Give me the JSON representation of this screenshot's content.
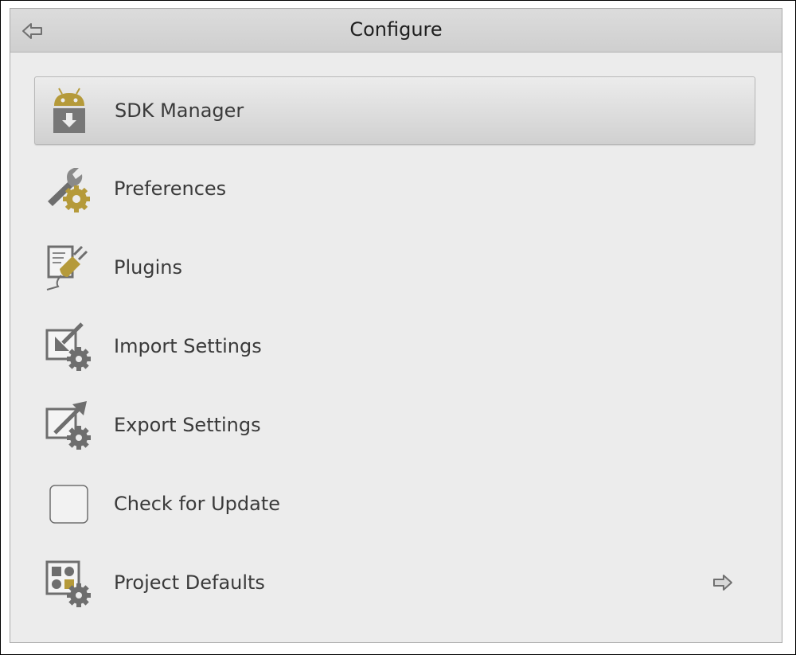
{
  "header": {
    "title": "Configure",
    "back_icon": "back-arrow-icon"
  },
  "items": [
    {
      "label": "SDK Manager",
      "icon": "sdk-manager-icon",
      "selected": true
    },
    {
      "label": "Preferences",
      "icon": "wrench-gear-icon",
      "selected": false
    },
    {
      "label": "Plugins",
      "icon": "plugin-icon",
      "selected": false
    },
    {
      "label": "Import Settings",
      "icon": "import-settings-icon",
      "selected": false
    },
    {
      "label": "Export Settings",
      "icon": "export-settings-icon",
      "selected": false
    },
    {
      "label": "Check for Update",
      "icon": "check-update-icon",
      "selected": false
    },
    {
      "label": "Project Defaults",
      "icon": "project-defaults-icon",
      "selected": false,
      "has_submenu": true
    }
  ],
  "colors": {
    "accent_gold": "#b59a3a",
    "icon_gray": "#6b6b6b",
    "selection": "#d6d6d6",
    "panel_bg": "#ececec"
  }
}
